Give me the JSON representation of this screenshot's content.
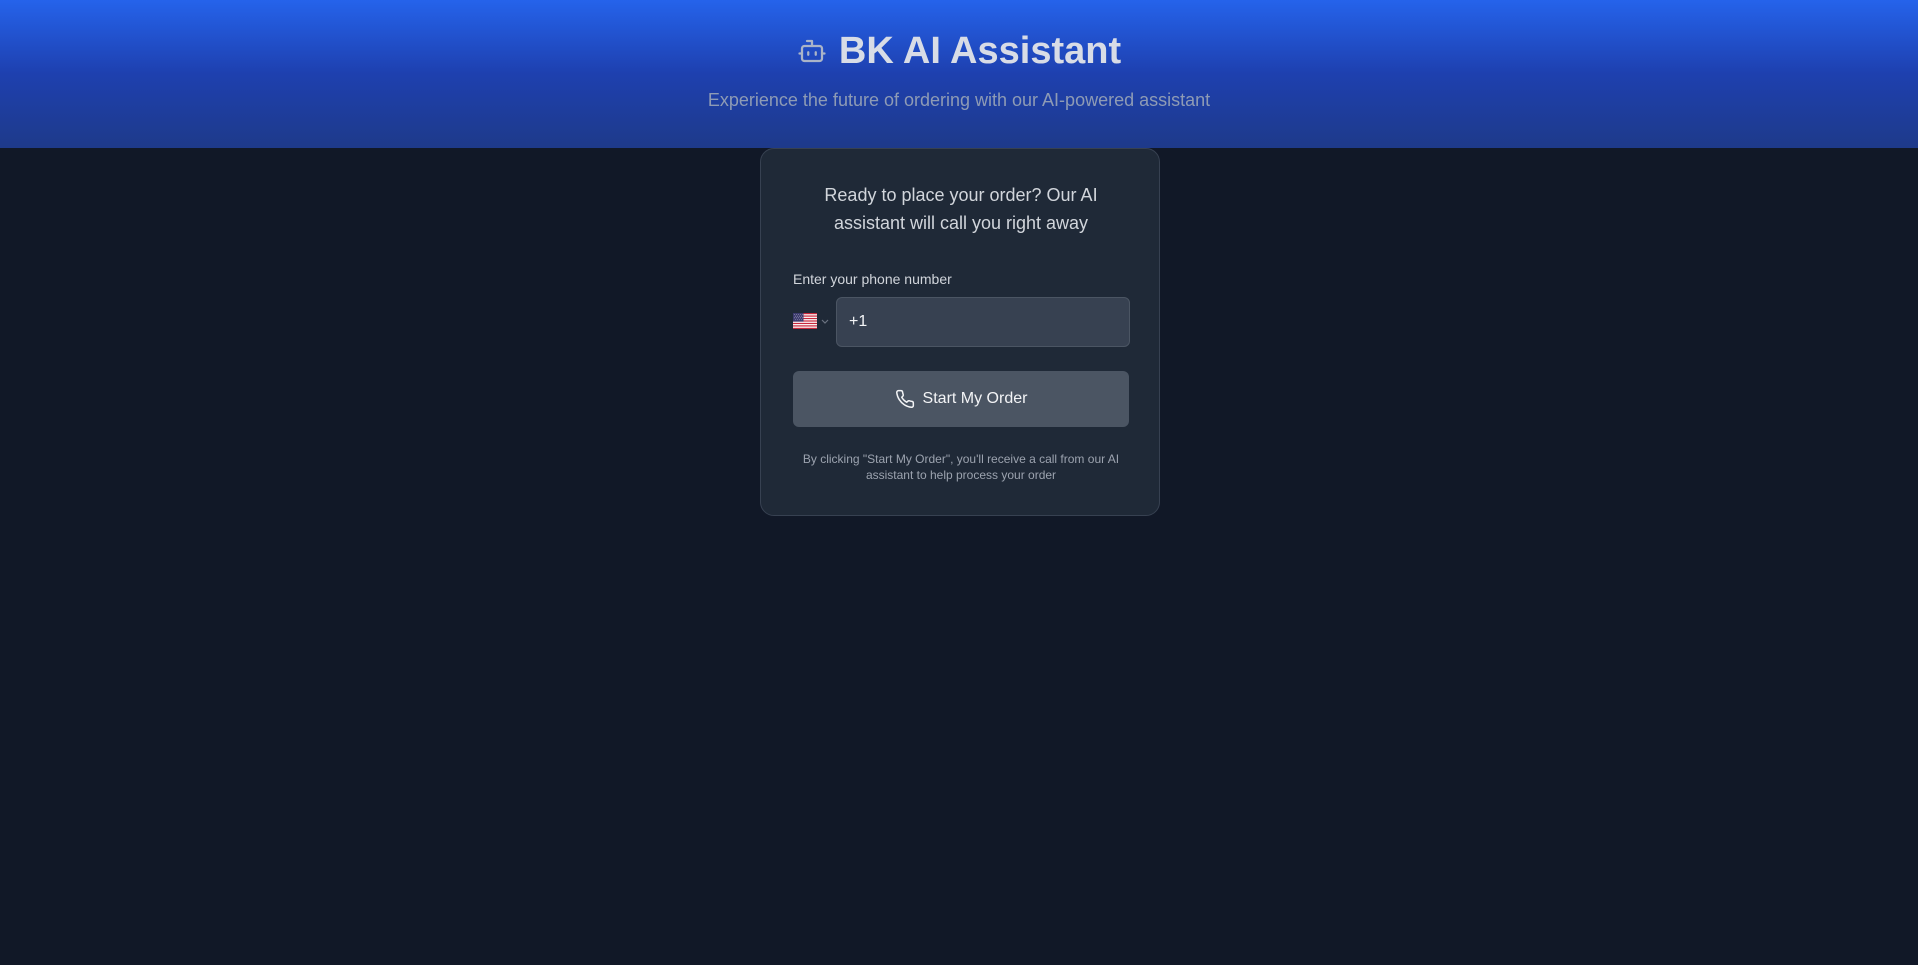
{
  "header": {
    "title": "BK AI Assistant",
    "subtitle": "Experience the future of ordering with our AI-powered assistant",
    "icon": "bot-icon"
  },
  "card": {
    "heading": "Ready to place your order? Our AI assistant will call you right away",
    "phone_label": "Enter your phone number",
    "country": "US",
    "phone_value": "+1",
    "button_label": "Start My Order",
    "disclaimer": "By clicking \"Start My Order\", you'll receive a call from our AI assistant to help process your order"
  },
  "colors": {
    "background": "#111827",
    "header_gradient_top": "#2563eb",
    "header_gradient_bottom": "#1e3a8a",
    "card_background": "#1f2937",
    "button_background": "#4b5563"
  }
}
